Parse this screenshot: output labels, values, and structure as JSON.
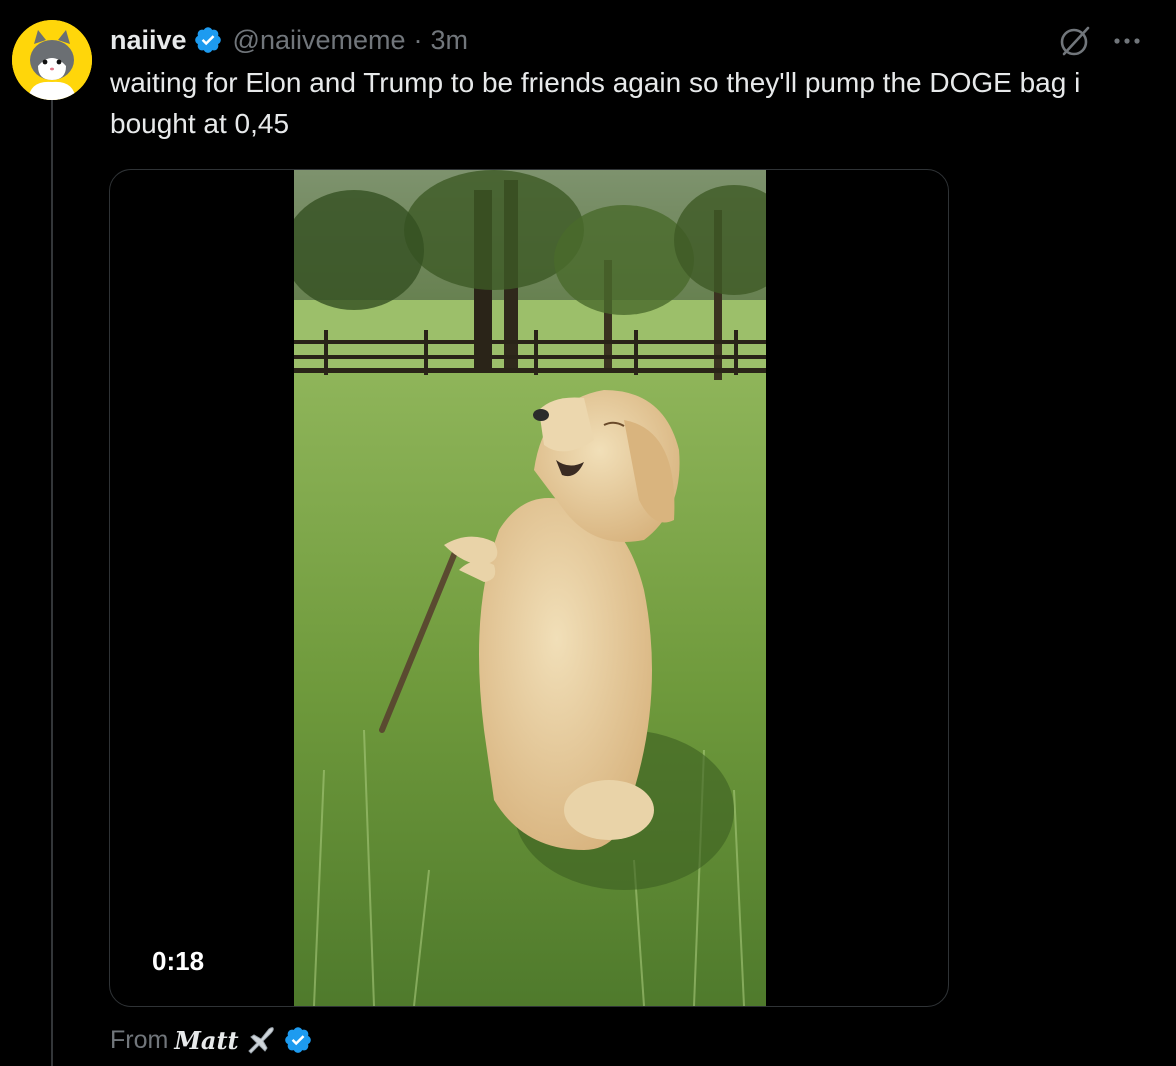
{
  "tweet": {
    "display_name": "naiive",
    "handle": "@naiivememe",
    "separator": "·",
    "time": "3m",
    "text": "waiting for Elon and Trump to be friends again so they'll pump the DOGE bag i bought at 0,45"
  },
  "media": {
    "duration": "0:18"
  },
  "attribution": {
    "from_label": "From",
    "source_name": "Matt"
  },
  "icons": {
    "verified": "verified-badge-icon",
    "grok": "grok-icon",
    "more": "more-options-icon",
    "plane": "airplane-emoji-icon"
  },
  "colors": {
    "background": "#000000",
    "text": "#e7e9ea",
    "secondary": "#71767b",
    "verified_blue": "#1d9bf0",
    "avatar_bg": "#ffd60a"
  }
}
